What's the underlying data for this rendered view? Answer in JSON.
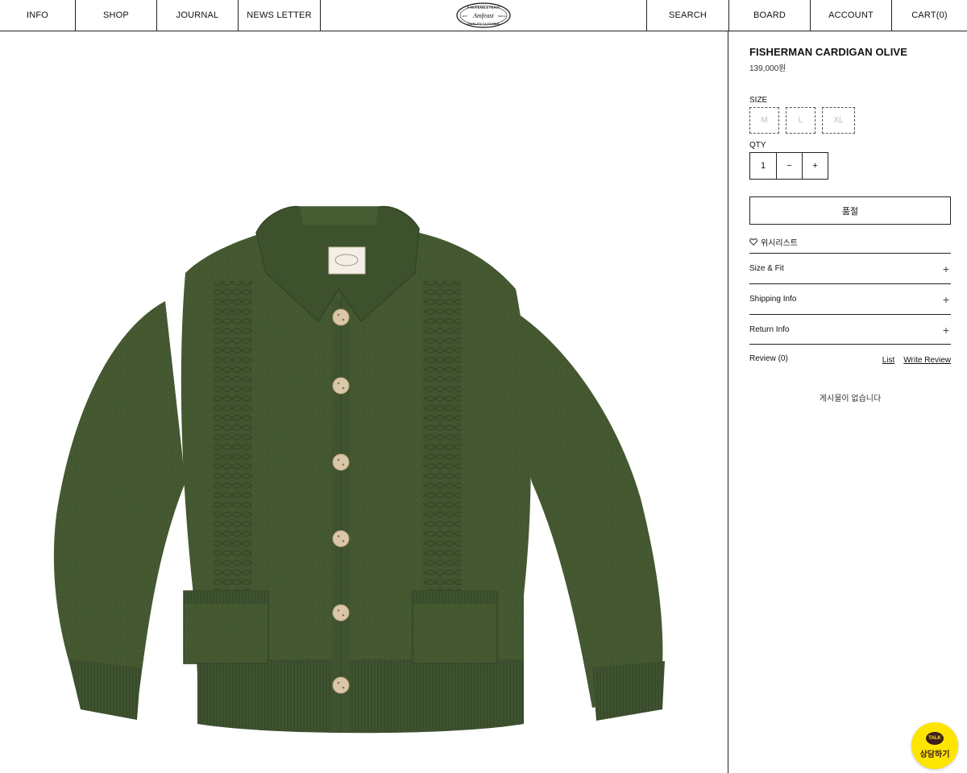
{
  "nav": {
    "left": [
      {
        "label": "INFO"
      },
      {
        "label": "SHOP"
      },
      {
        "label": "JOURNAL"
      },
      {
        "label": "NEWS LETTER"
      }
    ],
    "logo": {
      "top_text": "A MOVEABLE FEAST",
      "middle_text": "Amfeast",
      "bottom_text": "QUALITY CLOTHING",
      "left_text": "EST",
      "right_text": "SEOUL"
    },
    "right": [
      {
        "label": "SEARCH"
      },
      {
        "label": "BOARD"
      },
      {
        "label": "ACCOUNT"
      },
      {
        "label": "CART(0)"
      }
    ]
  },
  "product": {
    "image_icon": "olive-cable-knit-cardigan-image",
    "color_main": "#44592f",
    "color_button": "#d9c7a7",
    "title": "FISHERMAN CARDIGAN OLIVE",
    "price": "139,000원",
    "size_label": "SIZE",
    "sizes": [
      "M",
      "L",
      "XL"
    ],
    "qty_label": "QTY",
    "qty": "1",
    "qty_minus": "−",
    "qty_plus": "+",
    "soldout_label": "품절",
    "wishlist_label": "위시리스트",
    "wishlist_icon": "heart-icon"
  },
  "accordion": [
    {
      "label": "Size & Fit",
      "icon": "+"
    },
    {
      "label": "Shipping Info",
      "icon": "+"
    },
    {
      "label": "Return Info",
      "icon": "+"
    }
  ],
  "review": {
    "label": "Review (0)",
    "list_link": "List",
    "write_link": "Write Review",
    "empty_message": "게시물이 없습니다"
  },
  "talk": {
    "bubble": "TALK",
    "label": "상담하기",
    "color": "#fee500"
  }
}
